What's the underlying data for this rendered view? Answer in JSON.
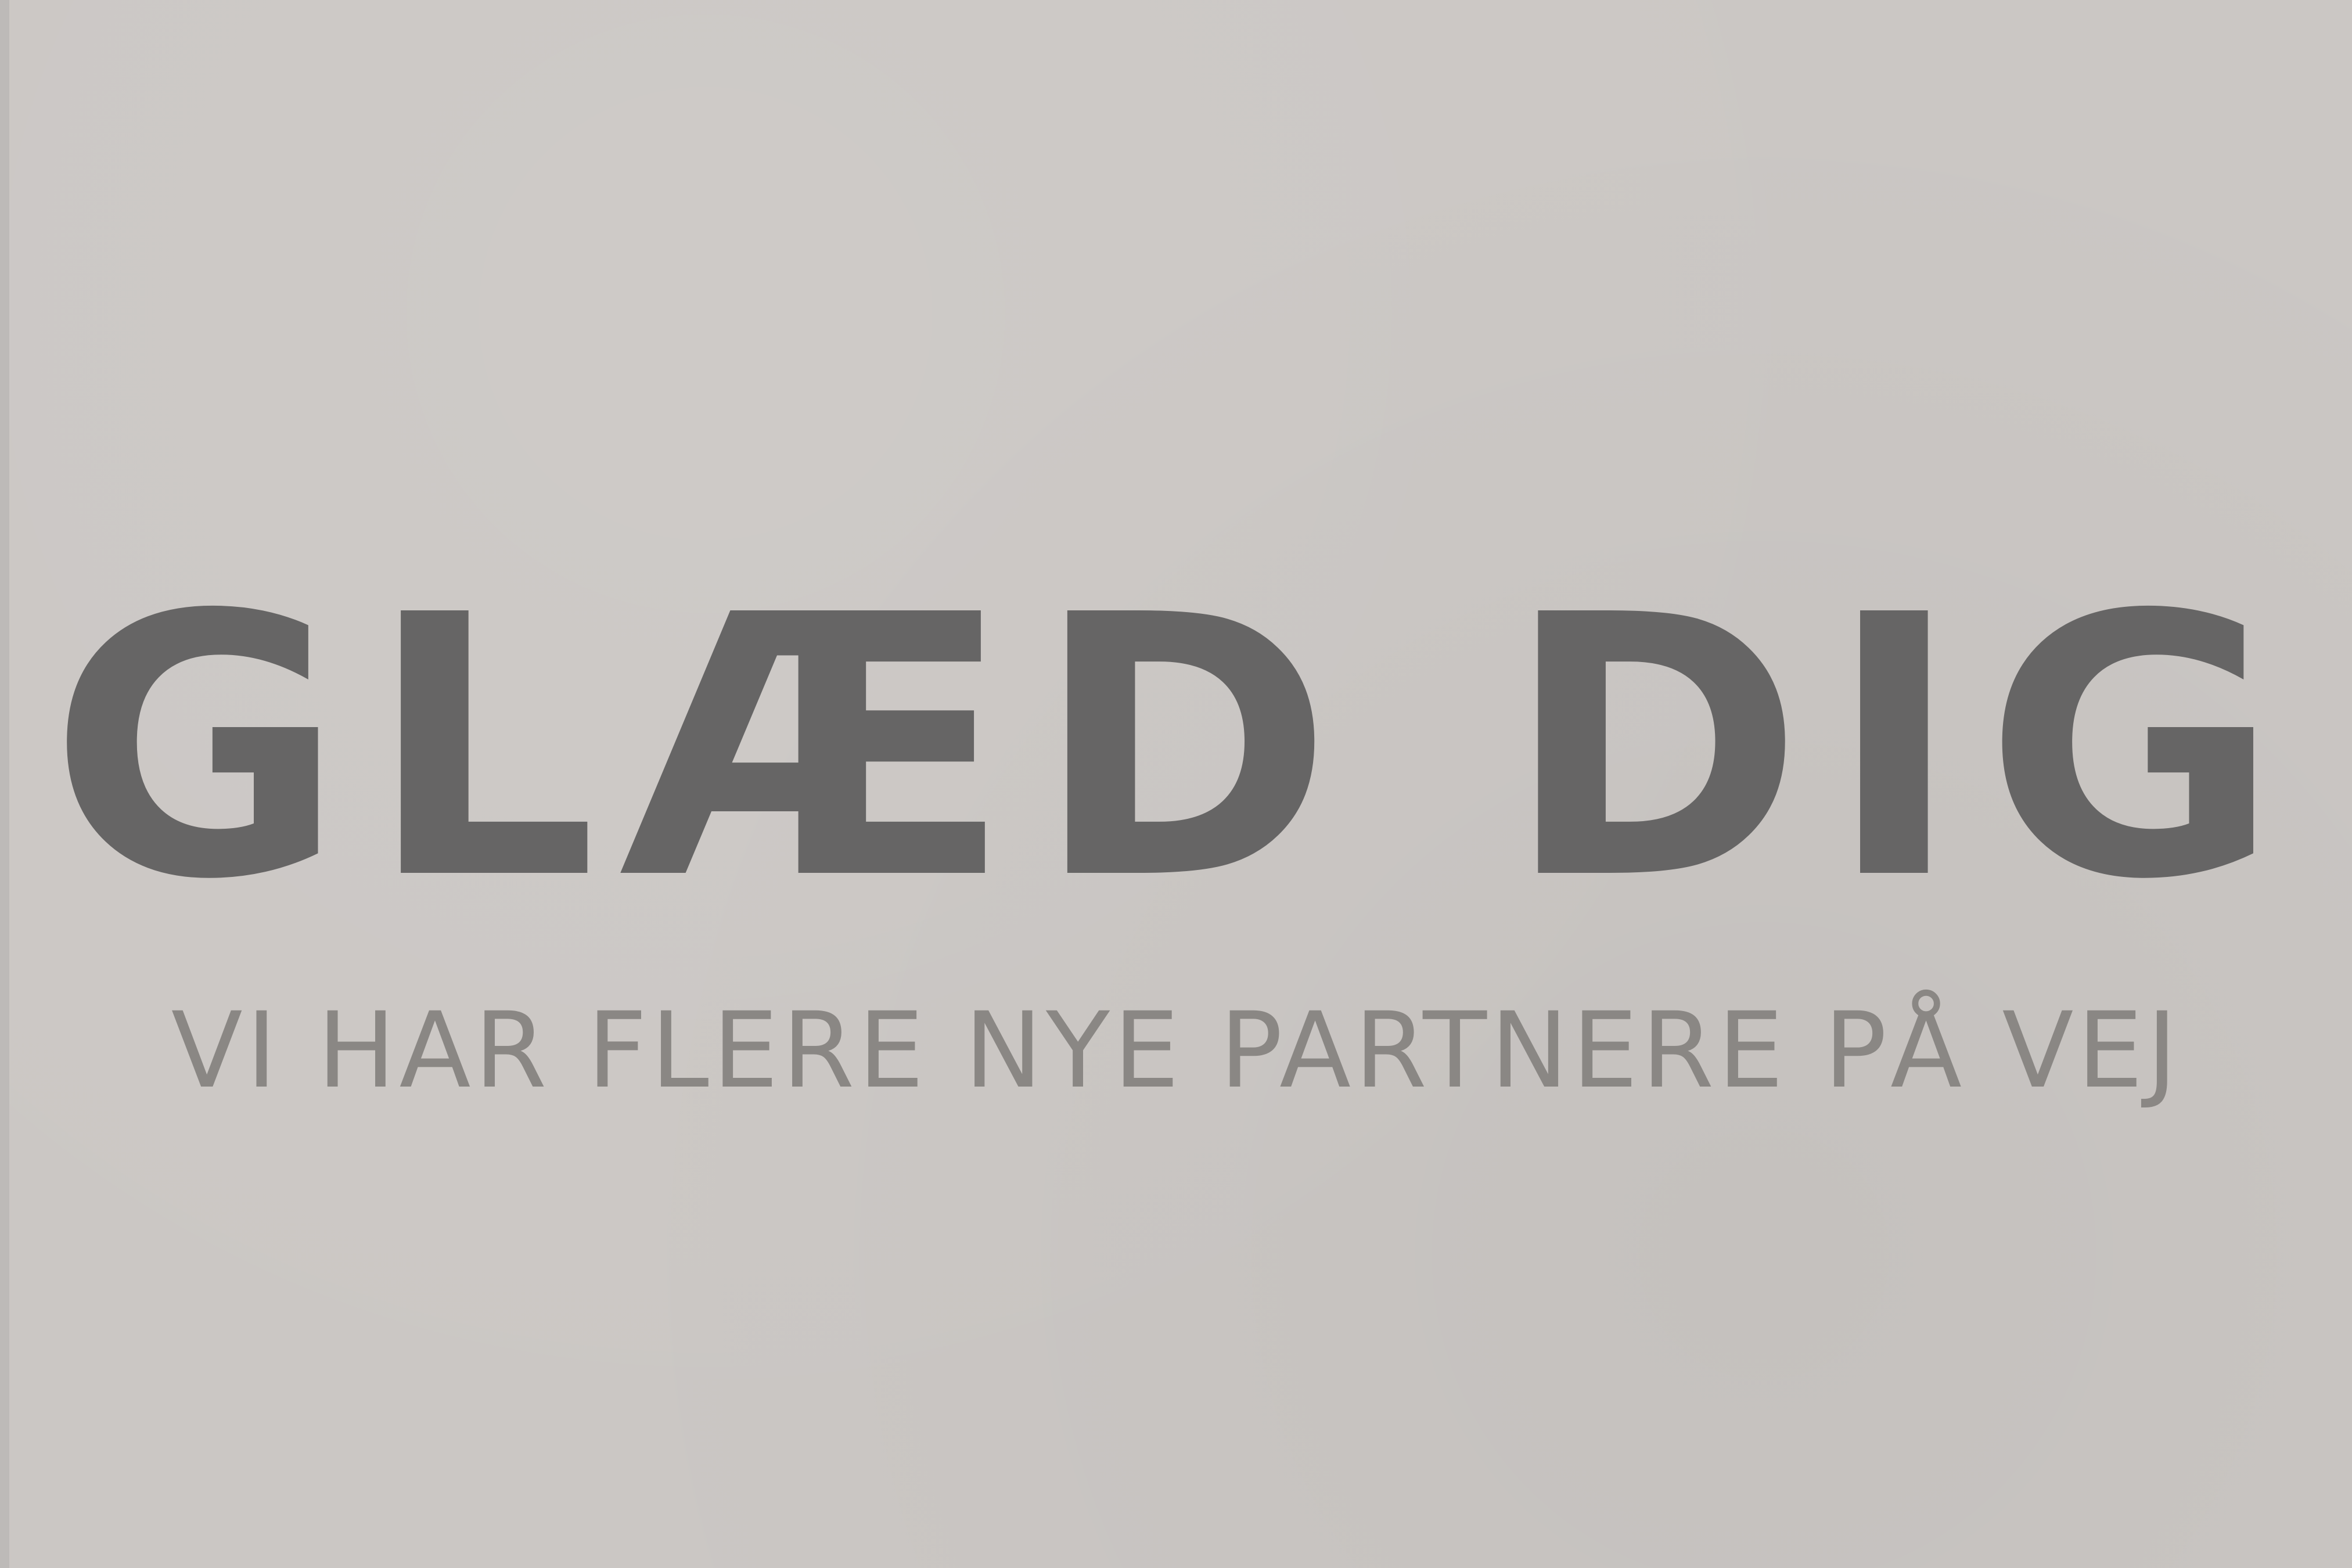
{
  "banner": {
    "headline": "GLÆD DIG",
    "subline": "VI HAR FLERE NYE PARTNERE PÅ VEJ"
  },
  "colors": {
    "background": "#cbc7c4",
    "headline": "#666565",
    "subline": "#8a8784"
  }
}
